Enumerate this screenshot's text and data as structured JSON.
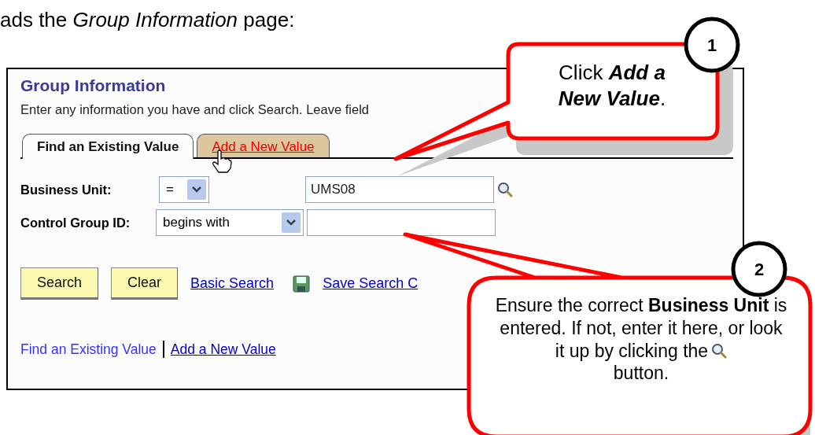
{
  "intro": "ads the *Group Information* page:",
  "panel": {
    "title": "Group Information",
    "instructions": "Enter any information you have and click Search. Leave field",
    "tabs": [
      {
        "label": "Find an Existing Value",
        "selected": true
      },
      {
        "label": "Add a New Value",
        "selected": false
      }
    ],
    "fields": [
      {
        "label": "Business Unit:",
        "operator": "=",
        "value": "UMS08",
        "lookup": true
      },
      {
        "label": "Control Group ID:",
        "operator": "begins with",
        "lookup": false
      }
    ],
    "buttons": [
      "Search",
      "Clear"
    ],
    "links": [
      {
        "label": "Basic Search",
        "kind": "plain"
      },
      {
        "label": "Save Search C",
        "kind": "save"
      }
    ],
    "footer_links": [
      {
        "label": "Find an Existing Value",
        "selected": true
      },
      {
        "label": "Add a New Value",
        "selected": false
      }
    ]
  },
  "callouts": [
    {
      "number": "1",
      "text": "Click **Add a New Value**.",
      "italic_emphasis": true
    },
    {
      "number": "2",
      "text": "Ensure the correct **Business Unit** is entered. If not, enter it here, or look",
      "text_icon_line": "it up by clicking the",
      "text_after": "button."
    }
  ]
}
